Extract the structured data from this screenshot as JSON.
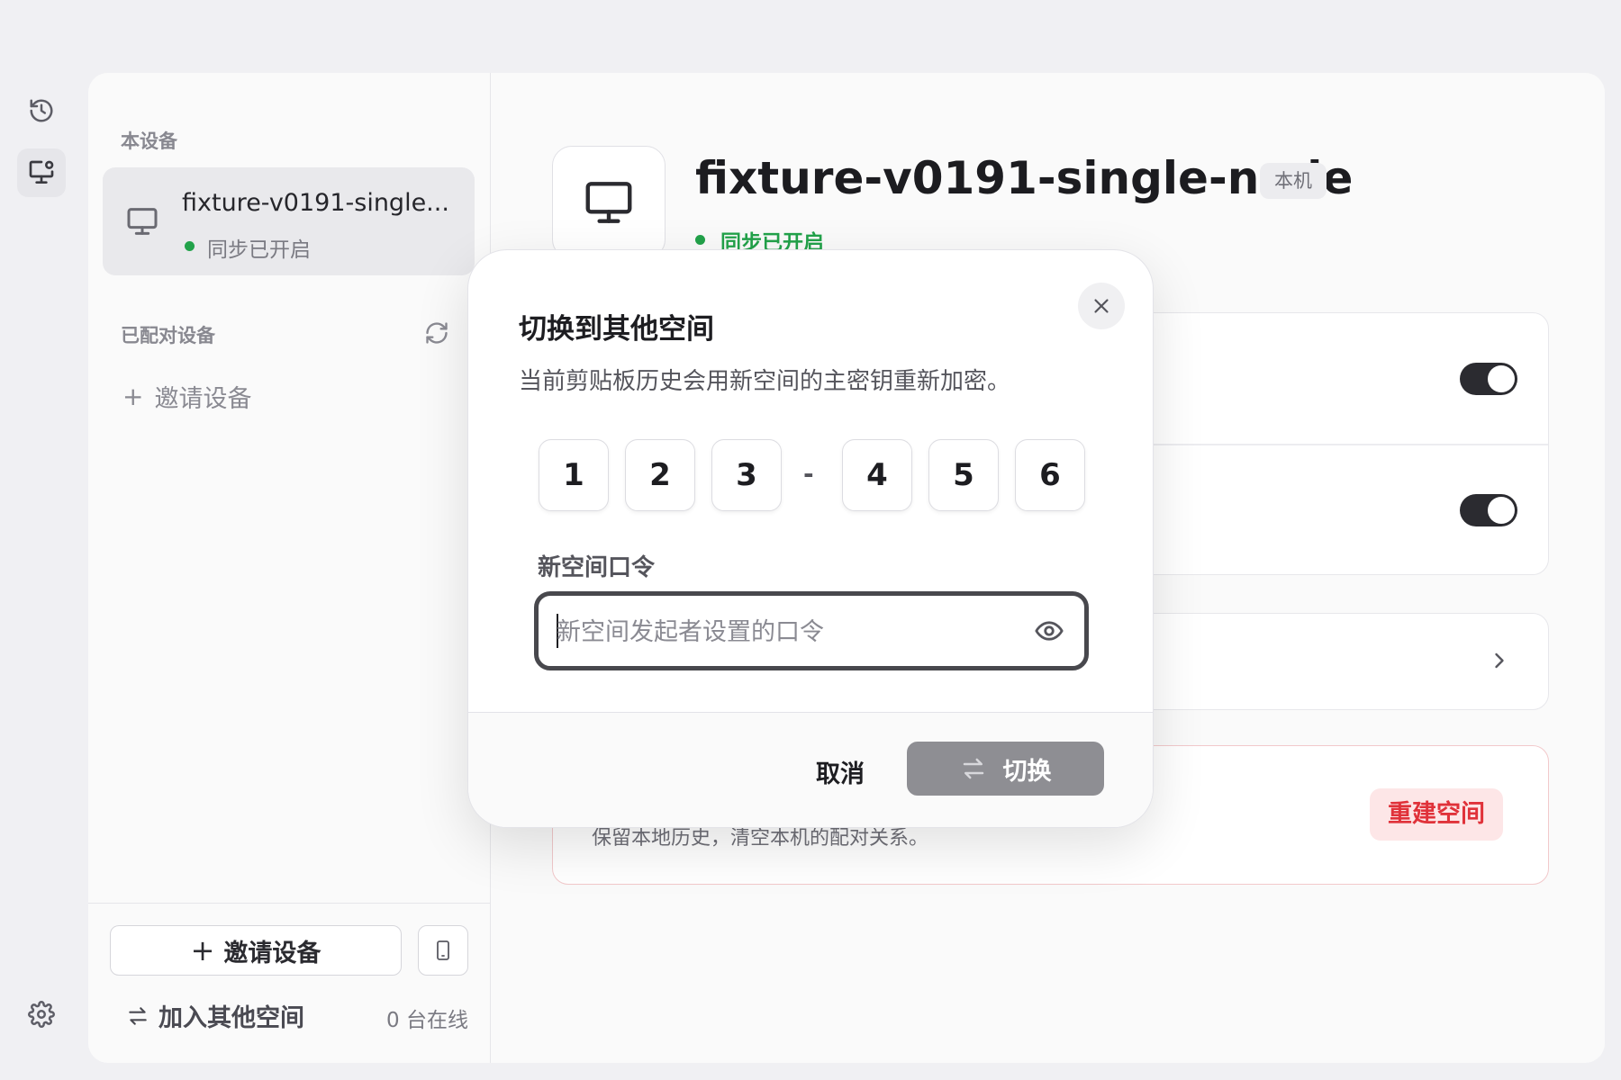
{
  "rail": {
    "icons": [
      "history-icon",
      "monitor-settings-icon",
      "gear-icon"
    ]
  },
  "sidebar": {
    "this_device_label": "本设备",
    "device_name": "fixture-v0191-single...",
    "device_status": "同步已开启",
    "paired_label": "已配对设备",
    "invite_link": "邀请设备",
    "invite_button": "邀请设备",
    "join_label": "加入其他空间",
    "online_count": "0 台在线"
  },
  "main": {
    "device_title": "fixture-v0191-single-node",
    "device_tag": "本机",
    "device_status": "同步已开启",
    "toggles": [
      true,
      true
    ],
    "danger_subtitle": "保留本地历史，清空本机的配对关系。",
    "rebuild_button": "重建空间"
  },
  "dialog": {
    "title": "切换到其他空间",
    "description": "当前剪贴板历史会用新空间的主密钥重新加密。",
    "code_digits": [
      "1",
      "2",
      "3",
      "4",
      "5",
      "6"
    ],
    "code_separator": "-",
    "password_label": "新空间口令",
    "password_placeholder": "新空间发起者设置的口令",
    "password_value": "",
    "cancel_label": "取消",
    "switch_label": "切换"
  },
  "colors": {
    "status_green": "#22a24a",
    "danger_red": "#e0323a",
    "disabled_button": "#8e8e93"
  }
}
